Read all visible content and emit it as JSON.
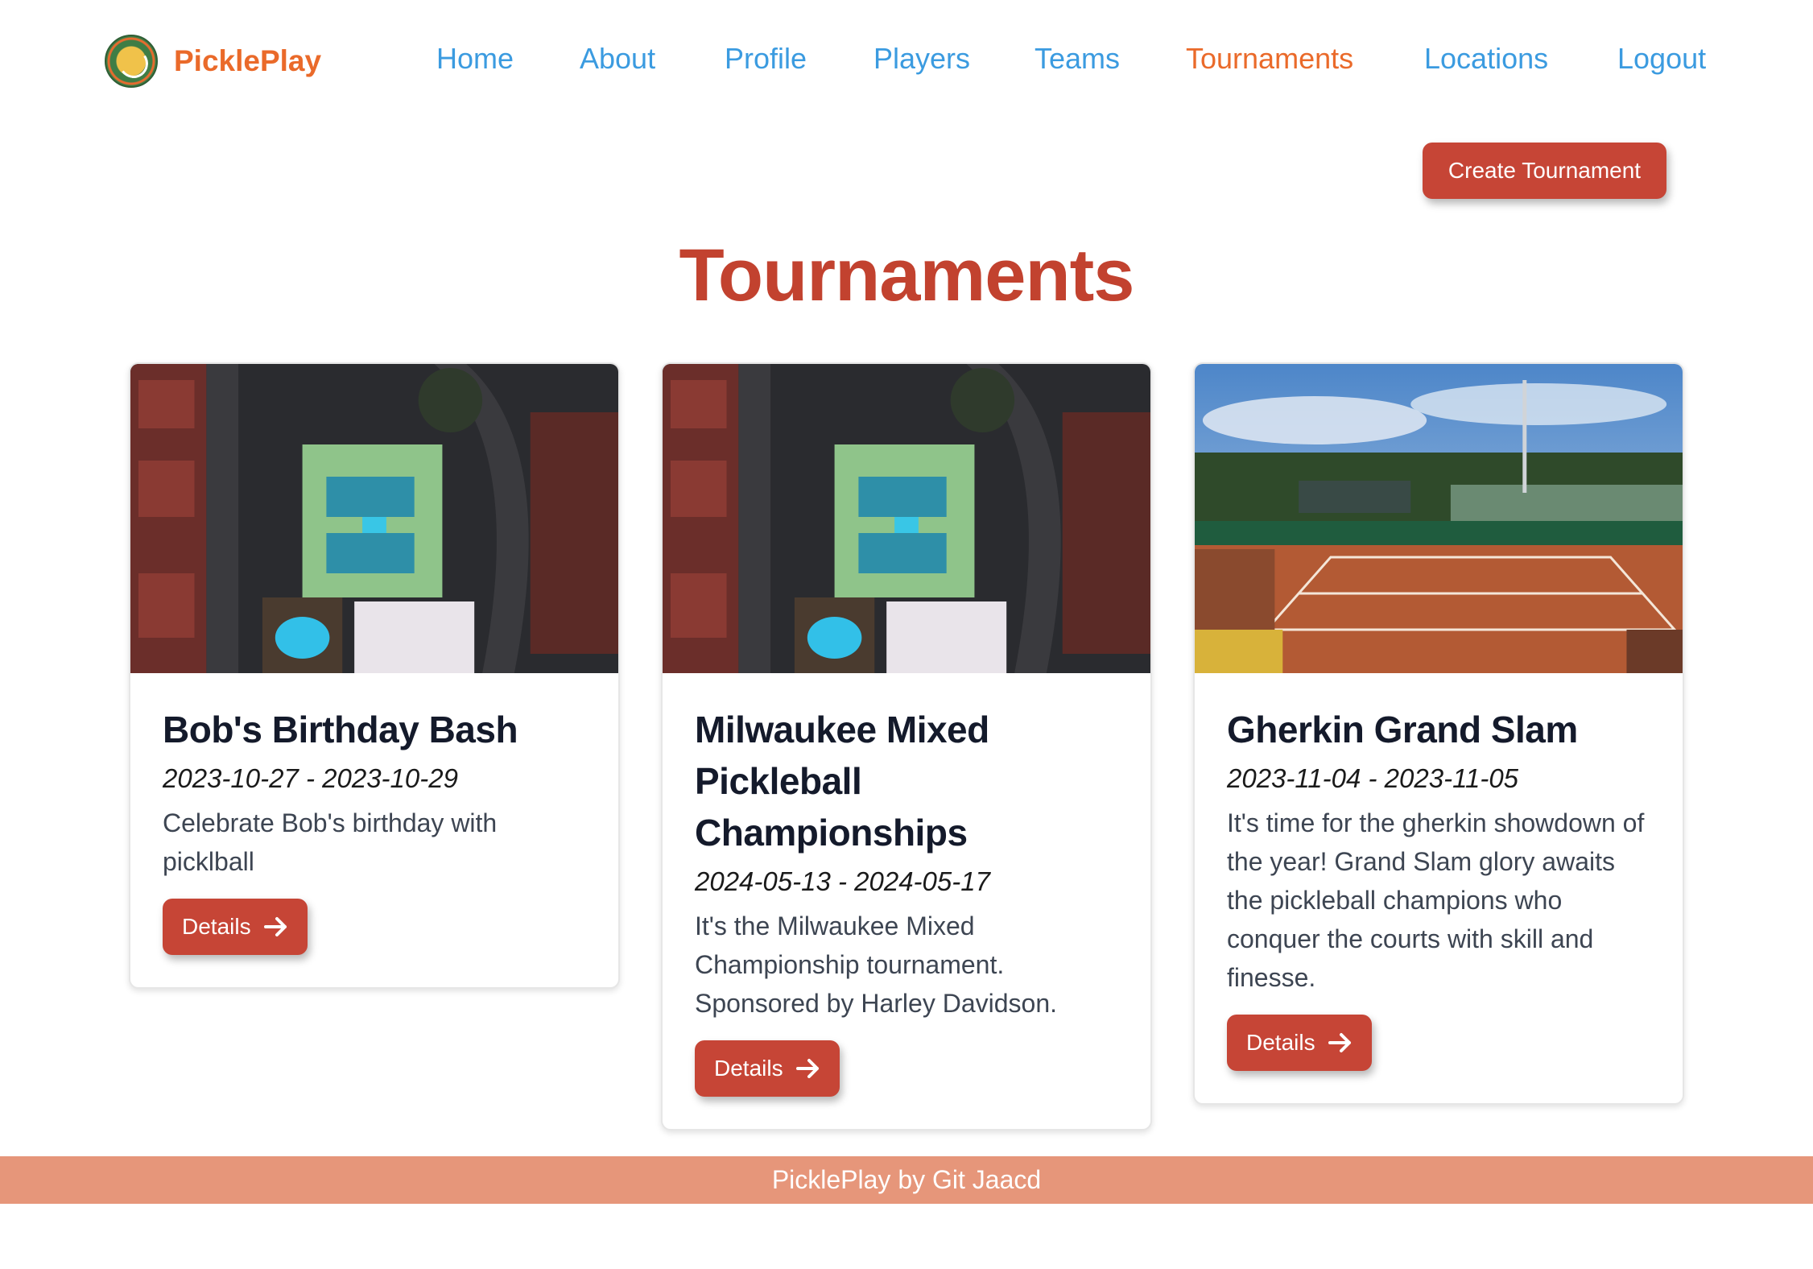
{
  "header": {
    "brand": "PicklePlay",
    "nav": [
      {
        "label": "Home",
        "active": false
      },
      {
        "label": "About",
        "active": false
      },
      {
        "label": "Profile",
        "active": false
      },
      {
        "label": "Players",
        "active": false
      },
      {
        "label": "Teams",
        "active": false
      },
      {
        "label": "Tournaments",
        "active": true
      },
      {
        "label": "Locations",
        "active": false
      },
      {
        "label": "Logout",
        "active": false
      }
    ]
  },
  "actions": {
    "create_label": "Create Tournament"
  },
  "page": {
    "title": "Tournaments"
  },
  "tournaments": [
    {
      "title": "Bob's Birthday Bash",
      "dates": "2023-10-27 - 2023-10-29",
      "description": "Celebrate Bob's birthday with picklball",
      "details_label": "Details",
      "image": "aerial-pickleball-courts-night"
    },
    {
      "title": "Milwaukee Mixed Pickleball Championships",
      "dates": "2024-05-13 - 2024-05-17",
      "description": "It's the Milwaukee Mixed Championship tournament. Sponsored by Harley Davidson.",
      "details_label": "Details",
      "image": "aerial-pickleball-courts-night"
    },
    {
      "title": "Gherkin Grand Slam",
      "dates": "2023-11-04 - 2023-11-05",
      "description": "It's time for the gherkin showdown of the year! Grand Slam glory awaits the pickleball champions who conquer the courts with skill and finesse.",
      "details_label": "Details",
      "image": "clay-court-stadium"
    }
  ],
  "footer": {
    "text": "PicklePlay by Git Jaacd"
  },
  "colors": {
    "accent": "#c64536",
    "brand_orange": "#ea6a2a",
    "nav_blue": "#3b9be0",
    "title_red": "#c2422f",
    "footer_bg": "#e6967a"
  }
}
